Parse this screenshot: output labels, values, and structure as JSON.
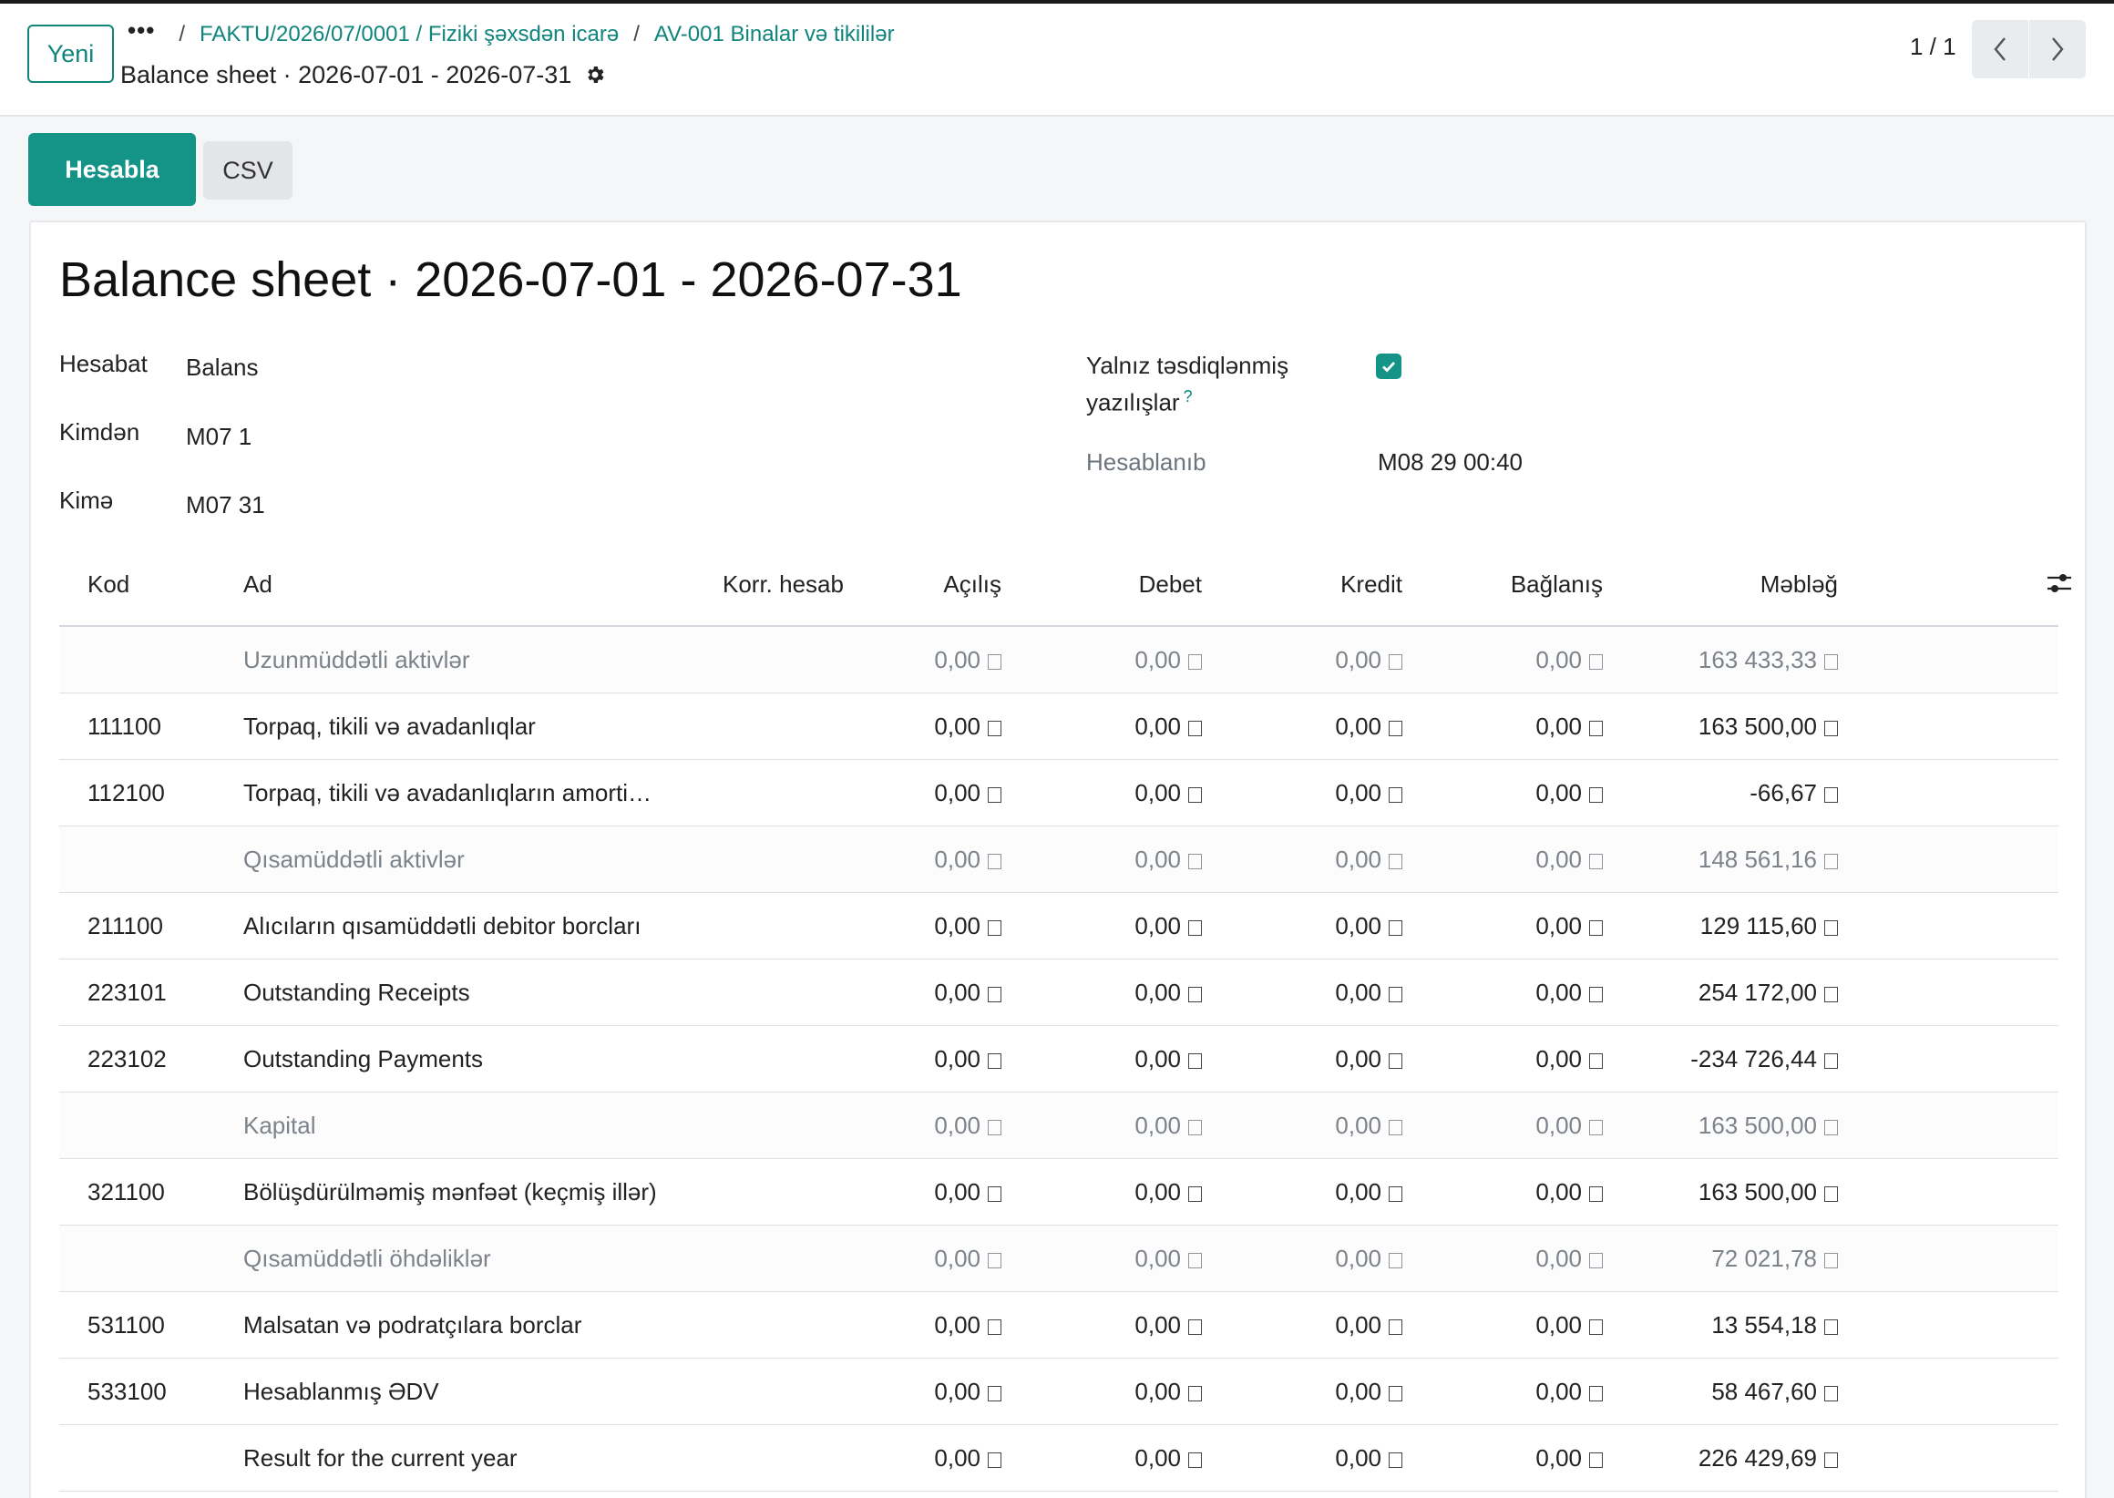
{
  "control_panel": {
    "new_button": "Yeni",
    "breadcrumb": {
      "dots": "•••",
      "sep": "/",
      "items": [
        "FAKTU/2026/07/0001 / Fiziki şəxsdən icarə",
        "AV-001 Binalar və tikililər"
      ]
    },
    "title": "Balance sheet · 2026-07-01 - 2026-07-31",
    "pager": "1 / 1"
  },
  "actions": {
    "compute": "Hesabla",
    "csv": "CSV"
  },
  "form": {
    "title": "Balance sheet · 2026-07-01 - 2026-07-31",
    "report_label": "Hesabat",
    "report_value": "Balans",
    "from_label": "Kimdən",
    "from_value": "M07 1",
    "to_label": "Kimə",
    "to_value": "M07 31",
    "posted_label_line1": "Yalnız təsdiqlənmiş",
    "posted_label_line2": "yazılışlar",
    "help_mark": "?",
    "posted_checked": true,
    "computed_label": "Hesablanıb",
    "computed_value": "M08 29 00:40"
  },
  "table": {
    "headers": {
      "code": "Kod",
      "name": "Ad",
      "counter": "Korr. hesab",
      "opening": "Açılış",
      "debit": "Debet",
      "credit": "Kredit",
      "closing": "Bağlanış",
      "amount": "Məbləğ"
    },
    "rows": [
      {
        "section": true,
        "code": "",
        "name": "Uzunmüddətli aktivlər",
        "opening": "0,00",
        "debit": "0,00",
        "credit": "0,00",
        "closing": "0,00",
        "amount": "163 433,33"
      },
      {
        "section": false,
        "code": "111100",
        "name": "Torpaq, tikili və avadanlıqlar",
        "opening": "0,00",
        "debit": "0,00",
        "credit": "0,00",
        "closing": "0,00",
        "amount": "163 500,00"
      },
      {
        "section": false,
        "code": "112100",
        "name": "Torpaq, tikili və avadanlıqların amorti…",
        "opening": "0,00",
        "debit": "0,00",
        "credit": "0,00",
        "closing": "0,00",
        "amount": "-66,67"
      },
      {
        "section": true,
        "code": "",
        "name": "Qısamüddətli aktivlər",
        "opening": "0,00",
        "debit": "0,00",
        "credit": "0,00",
        "closing": "0,00",
        "amount": "148 561,16"
      },
      {
        "section": false,
        "code": "211100",
        "name": "Alıcıların qısamüddətli debitor borcları",
        "opening": "0,00",
        "debit": "0,00",
        "credit": "0,00",
        "closing": "0,00",
        "amount": "129 115,60"
      },
      {
        "section": false,
        "code": "223101",
        "name": "Outstanding Receipts",
        "opening": "0,00",
        "debit": "0,00",
        "credit": "0,00",
        "closing": "0,00",
        "amount": "254 172,00"
      },
      {
        "section": false,
        "code": "223102",
        "name": "Outstanding Payments",
        "opening": "0,00",
        "debit": "0,00",
        "credit": "0,00",
        "closing": "0,00",
        "amount": "-234 726,44"
      },
      {
        "section": true,
        "code": "",
        "name": "Kapital",
        "opening": "0,00",
        "debit": "0,00",
        "credit": "0,00",
        "closing": "0,00",
        "amount": "163 500,00"
      },
      {
        "section": false,
        "code": "321100",
        "name": "Bölüşdürülməmiş mənfəət (keçmiş illər)",
        "opening": "0,00",
        "debit": "0,00",
        "credit": "0,00",
        "closing": "0,00",
        "amount": "163 500,00"
      },
      {
        "section": true,
        "code": "",
        "name": "Qısamüddətli öhdəliklər",
        "opening": "0,00",
        "debit": "0,00",
        "credit": "0,00",
        "closing": "0,00",
        "amount": "72 021,78"
      },
      {
        "section": false,
        "code": "531100",
        "name": "Malsatan və podratçılara borclar",
        "opening": "0,00",
        "debit": "0,00",
        "credit": "0,00",
        "closing": "0,00",
        "amount": "13 554,18"
      },
      {
        "section": false,
        "code": "533100",
        "name": "Hesablanmış ƏDV",
        "opening": "0,00",
        "debit": "0,00",
        "credit": "0,00",
        "closing": "0,00",
        "amount": "58 467,60"
      },
      {
        "section": false,
        "code": "",
        "name": "Result for the current year",
        "opening": "0,00",
        "debit": "0,00",
        "credit": "0,00",
        "closing": "0,00",
        "amount": "226 429,69"
      }
    ]
  },
  "colors": {
    "primary": "#139487",
    "link": "#0f857c",
    "muted_text": "#7d838a"
  }
}
